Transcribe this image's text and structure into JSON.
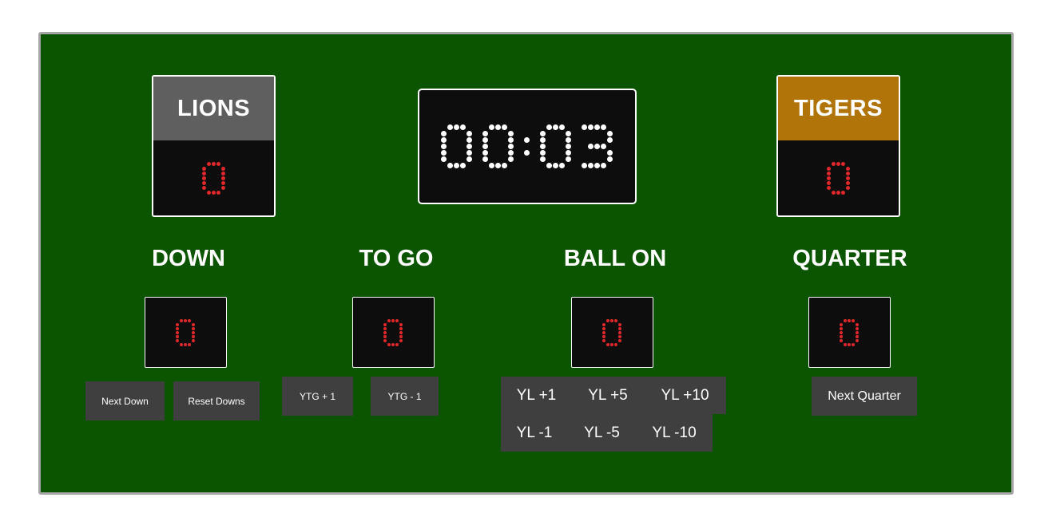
{
  "home": {
    "name": "LIONS",
    "score": "0",
    "color": "#5f5f5f"
  },
  "away": {
    "name": "TIGERS",
    "score": "0",
    "color": "#b07408"
  },
  "clock": {
    "display": "00:03"
  },
  "down": {
    "label": "DOWN",
    "value": "0",
    "next_label": "Next Down",
    "reset_label": "Reset Downs"
  },
  "to_go": {
    "label": "TO GO",
    "value": "0",
    "plus_label": "YTG + 1",
    "minus_label": "YTG - 1"
  },
  "ball_on": {
    "label": "BALL ON",
    "value": "0",
    "buttons": [
      "YL +1",
      "YL +5",
      "YL +10",
      "YL -1",
      "YL -5",
      "YL -10"
    ]
  },
  "quarter": {
    "label": "QUARTER",
    "value": "0",
    "next_label": "Next Quarter"
  },
  "colors": {
    "field": "#0b5400",
    "panel": "#0d0d0d",
    "led_score": "#e0282a",
    "led_clock": "#ffffff",
    "button": "#3f3f3f"
  }
}
